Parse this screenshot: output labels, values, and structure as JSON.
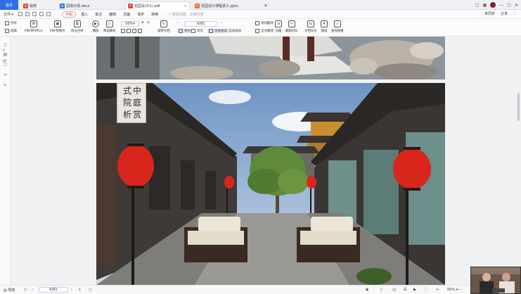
{
  "tabs": {
    "home": "首页",
    "items": [
      {
        "label": "稻壳",
        "icon": "D",
        "color": "#e24a3b"
      },
      {
        "label": "园境大观.docx",
        "icon": "W",
        "color": "#2f6fe4"
      },
      {
        "label": "花园设计(1).pdf",
        "icon": "P",
        "color": "#e24a3b",
        "active": true
      },
      {
        "label": "花园设计课程讲义.pptx",
        "icon": "P",
        "color": "#e8743b"
      }
    ],
    "add": "+"
  },
  "menubar": {
    "file": "文件",
    "items": [
      "开始",
      "插入",
      "批注",
      "编辑",
      "页面",
      "保护",
      "转换"
    ],
    "search": "查找功能、文档内容",
    "right": [
      "未同步",
      "分享"
    ]
  },
  "toolbar": {
    "left_small": [
      "手形",
      "选择"
    ],
    "buttons": [
      "PDF转Office",
      "PDF转图片",
      "拆分合并",
      "播放",
      "阅读模式",
      "旋转文档"
    ],
    "zoom": "50%",
    "page": "6/81",
    "view_small": [
      "单页",
      "双页",
      "连续阅读",
      "自动滚动"
    ],
    "right_small": [
      "划词翻译",
      "全文翻译"
    ],
    "right_buttons": [
      "压缩",
      "截图对比",
      "文档比对",
      "朗读",
      "查找替换"
    ]
  },
  "document": {
    "seal_text": [
      "中",
      "式",
      "庭",
      "院",
      "赏",
      "析"
    ]
  },
  "statusbar": {
    "left": "导航",
    "page": "6/81",
    "zoom": "50%",
    "zoom_in": "+",
    "zoom_out": "−"
  },
  "colors": {
    "accent": "#2f6fe4",
    "start_tab": "#c0392b",
    "lantern": "#d8261c"
  }
}
